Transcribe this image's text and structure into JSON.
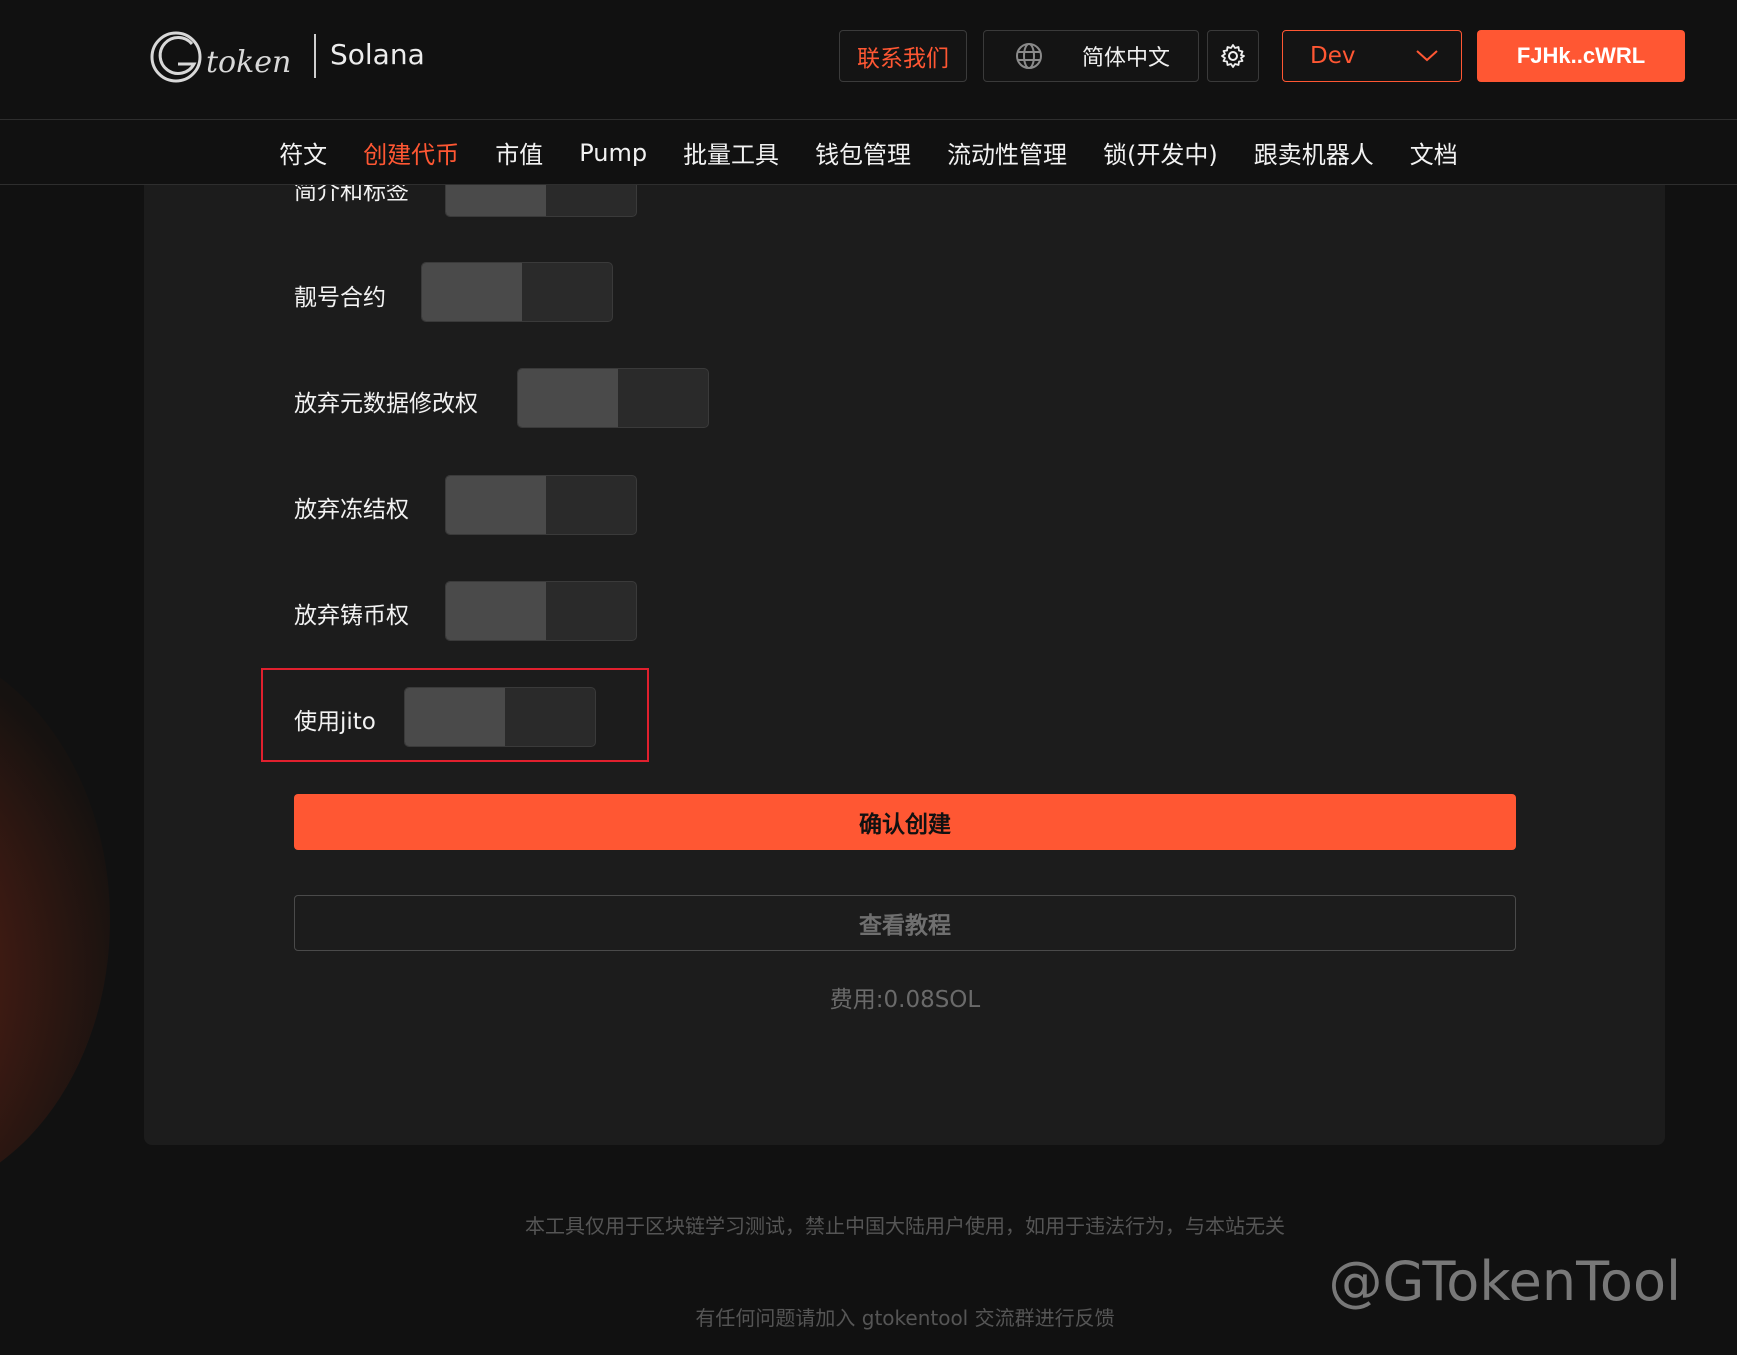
{
  "header": {
    "logo_text": "token",
    "chain": "Solana",
    "contact": "联系我们",
    "language": "简体中文",
    "network": "Dev",
    "wallet": "FJHk..cWRL"
  },
  "nav": {
    "items": [
      {
        "label": "符文",
        "active": false
      },
      {
        "label": "创建代币",
        "active": true
      },
      {
        "label": "市值",
        "active": false
      },
      {
        "label": "Pump",
        "active": false
      },
      {
        "label": "批量工具",
        "active": false
      },
      {
        "label": "钱包管理",
        "active": false
      },
      {
        "label": "流动性管理",
        "active": false
      },
      {
        "label": "锁(开发中)",
        "active": false
      },
      {
        "label": "跟卖机器人",
        "active": false
      },
      {
        "label": "文档",
        "active": false
      }
    ]
  },
  "form": {
    "toggles": [
      {
        "label": "简介和标签",
        "on": false
      },
      {
        "label": "靓号合约",
        "on": false
      },
      {
        "label": "放弃元数据修改权",
        "on": false
      },
      {
        "label": "放弃冻结权",
        "on": false
      },
      {
        "label": "放弃铸币权",
        "on": false
      },
      {
        "label": "使用jito",
        "on": false
      }
    ],
    "confirm": "确认创建",
    "tutorial": "查看教程",
    "fee": "费用:0.08SOL"
  },
  "footer": {
    "disclaimer": "本工具仅用于区块链学习测试，禁止中国大陆用户使用，如用于违法行为，与本站无关",
    "feedback": "有任何问题请加入 gtokentool 交流群进行反馈"
  },
  "watermark": "@GTokenTool",
  "colors": {
    "accent": "#ff5733",
    "background": "#111111",
    "card": "#1c1c1c",
    "highlight": "#e0202e"
  }
}
